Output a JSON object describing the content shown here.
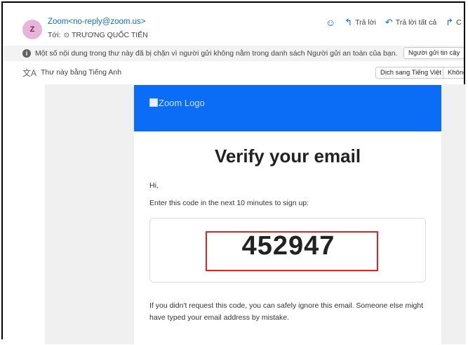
{
  "sender": {
    "avatar_letter": "Z",
    "from": "Zoom<no-reply@zoom.us>",
    "to_label": "Tới:",
    "to_icon": "person-circle-icon",
    "to_name": "TRƯƠNG QUỐC TIẾN"
  },
  "actions": {
    "emoji_icon": "smiley-icon",
    "reply": "Trả lời",
    "reply_all": "Trả lời tất cả",
    "forward_partial": "C"
  },
  "block_banner": {
    "text": "Một số nội dung trong thư này đã bị chặn vì người gửi không nằm trong danh sách Người gửi an toàn của bạn.",
    "button": "Người gửi tin cậy"
  },
  "translate_banner": {
    "text": "Thư này bằng Tiếng Anh",
    "translate_button": "Dịch sang Tiếng Việt",
    "never_button": "Không"
  },
  "email": {
    "logo_alt": "Zoom Logo",
    "title": "Verify your email",
    "greeting": "Hi,",
    "instruction": "Enter this code in the next 10 minutes to sign up:",
    "code": "452947",
    "footer": "If you didn't request this code, you can safely ignore this email. Someone else might have typed your email address by mistake."
  },
  "colors": {
    "accent": "#0f6cbd",
    "zoom_blue": "#0b6cf5",
    "highlight_red": "#e02424"
  }
}
